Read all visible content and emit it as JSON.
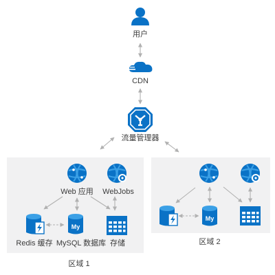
{
  "diagram": {
    "nodes": {
      "user": {
        "label": "用户",
        "icon": "user-icon"
      },
      "cdn": {
        "label": "CDN",
        "icon": "cloud-icon"
      },
      "traffic_manager": {
        "label": "流量管理器",
        "icon": "traffic-manager-icon"
      }
    },
    "regions": [
      {
        "label": "区域 1",
        "nodes": {
          "web_app": {
            "label": "Web 应用",
            "icon": "web-app-globe-icon"
          },
          "webjobs": {
            "label": "WebJobs",
            "icon": "webjobs-globe-gear-icon"
          },
          "redis": {
            "label": "Redis 缓存",
            "icon": "redis-cache-icon"
          },
          "mysql": {
            "label": "MySQL 数据库",
            "icon": "mysql-database-icon"
          },
          "storage": {
            "label": "存储",
            "icon": "storage-table-icon"
          }
        }
      },
      {
        "label": "区域 2",
        "nodes": {
          "web_app": {
            "icon": "web-app-globe-icon"
          },
          "webjobs": {
            "icon": "webjobs-globe-gear-icon"
          },
          "redis": {
            "icon": "redis-cache-icon"
          },
          "mysql": {
            "icon": "mysql-database-icon"
          },
          "storage": {
            "icon": "storage-table-icon"
          }
        }
      }
    ],
    "colors": {
      "icon_blue": "#0a72c6",
      "icon_light_blue": "#3ba0e6",
      "arrow_gray": "#b1b1b1",
      "region_bg": "#f1f1f2",
      "text": "#3b3b3b"
    }
  }
}
